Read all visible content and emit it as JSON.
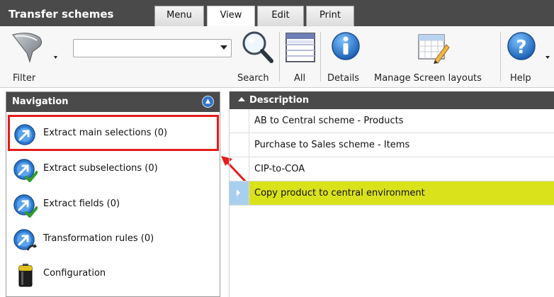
{
  "app": {
    "title": "Transfer schemes"
  },
  "tabs": [
    {
      "label": "Menu"
    },
    {
      "label": "View"
    },
    {
      "label": "Edit"
    },
    {
      "label": "Print"
    }
  ],
  "ribbon": {
    "filter_label": "Filter",
    "search_value": "",
    "search_label": "Search",
    "all_label": "All",
    "details_label": "Details",
    "layouts_label": "Manage Screen layouts",
    "help_label": "Help",
    "icons": [
      "filter-funnel-icon",
      "magnifier-icon",
      "grid-icon",
      "info-icon",
      "screen-layout-icon",
      "help-icon"
    ]
  },
  "navigation": {
    "title": "Navigation",
    "items": [
      {
        "label": "Extract main selections (0)",
        "icon": "extract-arrow-icon"
      },
      {
        "label": "Extract subselections (0)",
        "icon": "extract-check-icon"
      },
      {
        "label": "Extract fields (0)",
        "icon": "extract-check-icon"
      },
      {
        "label": "Transformation rules (0)",
        "icon": "transformation-icon"
      },
      {
        "label": "Configuration",
        "icon": "battery-icon"
      }
    ]
  },
  "grid": {
    "header": "Description",
    "rows": [
      {
        "description": "AB to Central scheme - Products"
      },
      {
        "description": "Purchase to Sales scheme - Items"
      },
      {
        "description": "CIP-to-COA"
      },
      {
        "description": "Copy product to central environment"
      }
    ]
  },
  "colors": {
    "header_bg": "#4a4a4a",
    "selected_row": "#d9e21b",
    "highlight": "#e51b1b",
    "accent_blue": "#2f76c9"
  }
}
